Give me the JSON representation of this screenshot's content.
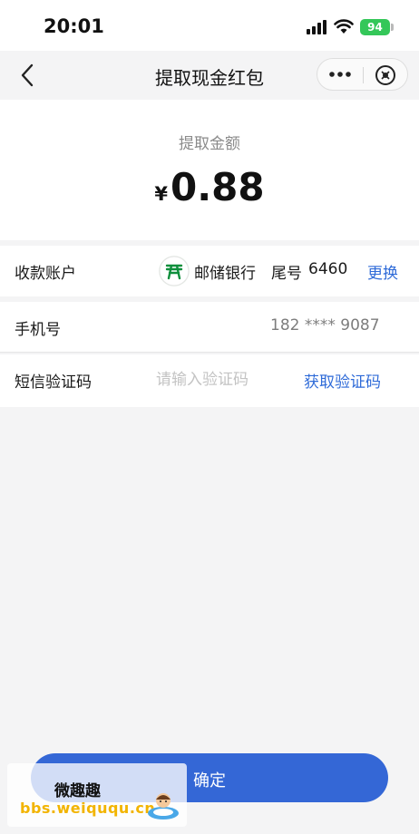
{
  "status_bar": {
    "time": "20:01",
    "battery": "94",
    "icons": [
      "signal-icon",
      "wifi-icon",
      "battery-icon"
    ]
  },
  "nav": {
    "title": "提取现金红包",
    "icons": [
      "back-icon",
      "more-icon",
      "close-icon"
    ]
  },
  "amount": {
    "label": "提取金额",
    "currency": "¥",
    "value": "0.88"
  },
  "account": {
    "label": "收款账户",
    "bank_name": "邮储银行",
    "tail_label": "尾号",
    "tail_number": "6460",
    "change_label": "更换",
    "bank_color": "#0f8f3c"
  },
  "phone": {
    "label": "手机号",
    "value": "182 **** 9087"
  },
  "sms": {
    "label": "短信验证码",
    "placeholder": "请输入验证码",
    "value": "",
    "get_code_label": "获取验证码"
  },
  "confirm": {
    "label": "确定",
    "color": "#3467d6"
  },
  "watermark": {
    "title": "微趣趣",
    "url": "bbs.weiququ.cn"
  },
  "colors": {
    "accent": "#2f6bd8",
    "background": "#f4f4f5",
    "battery": "#34c759"
  }
}
